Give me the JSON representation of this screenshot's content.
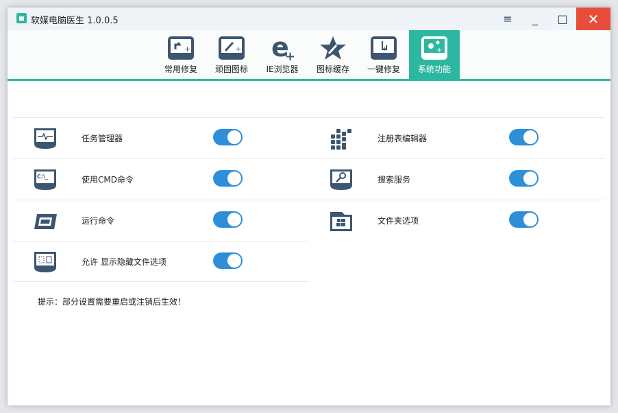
{
  "window": {
    "title": "软媒电脑医生 1.0.0.5"
  },
  "controls": {
    "menu": "≡",
    "minimize": "_",
    "maximize": "□",
    "close": "✕"
  },
  "tabs": [
    {
      "label": "常用修复",
      "icon": "shortcut-repair-icon"
    },
    {
      "label": "顽固图标",
      "icon": "wrench-monitor-icon"
    },
    {
      "label": "IE浏览器",
      "icon": "ie-icon"
    },
    {
      "label": "图标缓存",
      "icon": "star-wrench-icon"
    },
    {
      "label": "一键修复",
      "icon": "hand-click-icon"
    },
    {
      "label": "系统功能",
      "icon": "gears-icon",
      "active": true
    }
  ],
  "items": [
    {
      "label": "任务管理器",
      "enabled": true,
      "icon": "task-manager-icon"
    },
    {
      "label": "注册表编辑器",
      "enabled": true,
      "icon": "registry-icon"
    },
    {
      "label": "使用CMD命令",
      "enabled": true,
      "icon": "cmd-icon"
    },
    {
      "label": "搜索服务",
      "enabled": true,
      "icon": "search-service-icon"
    },
    {
      "label": "运行命令",
      "enabled": true,
      "icon": "run-icon"
    },
    {
      "label": "文件夹选项",
      "enabled": true,
      "icon": "folder-options-icon"
    },
    {
      "label": "允许 显示隐藏文件选项",
      "enabled": true,
      "icon": "hidden-files-icon"
    }
  ],
  "hint": "提示：部分设置需要重启或注销后生效！",
  "colors": {
    "accent": "#2db7a0",
    "toggle": "#2d8fd8",
    "close": "#e84c3a",
    "icon": "#3d5670"
  }
}
